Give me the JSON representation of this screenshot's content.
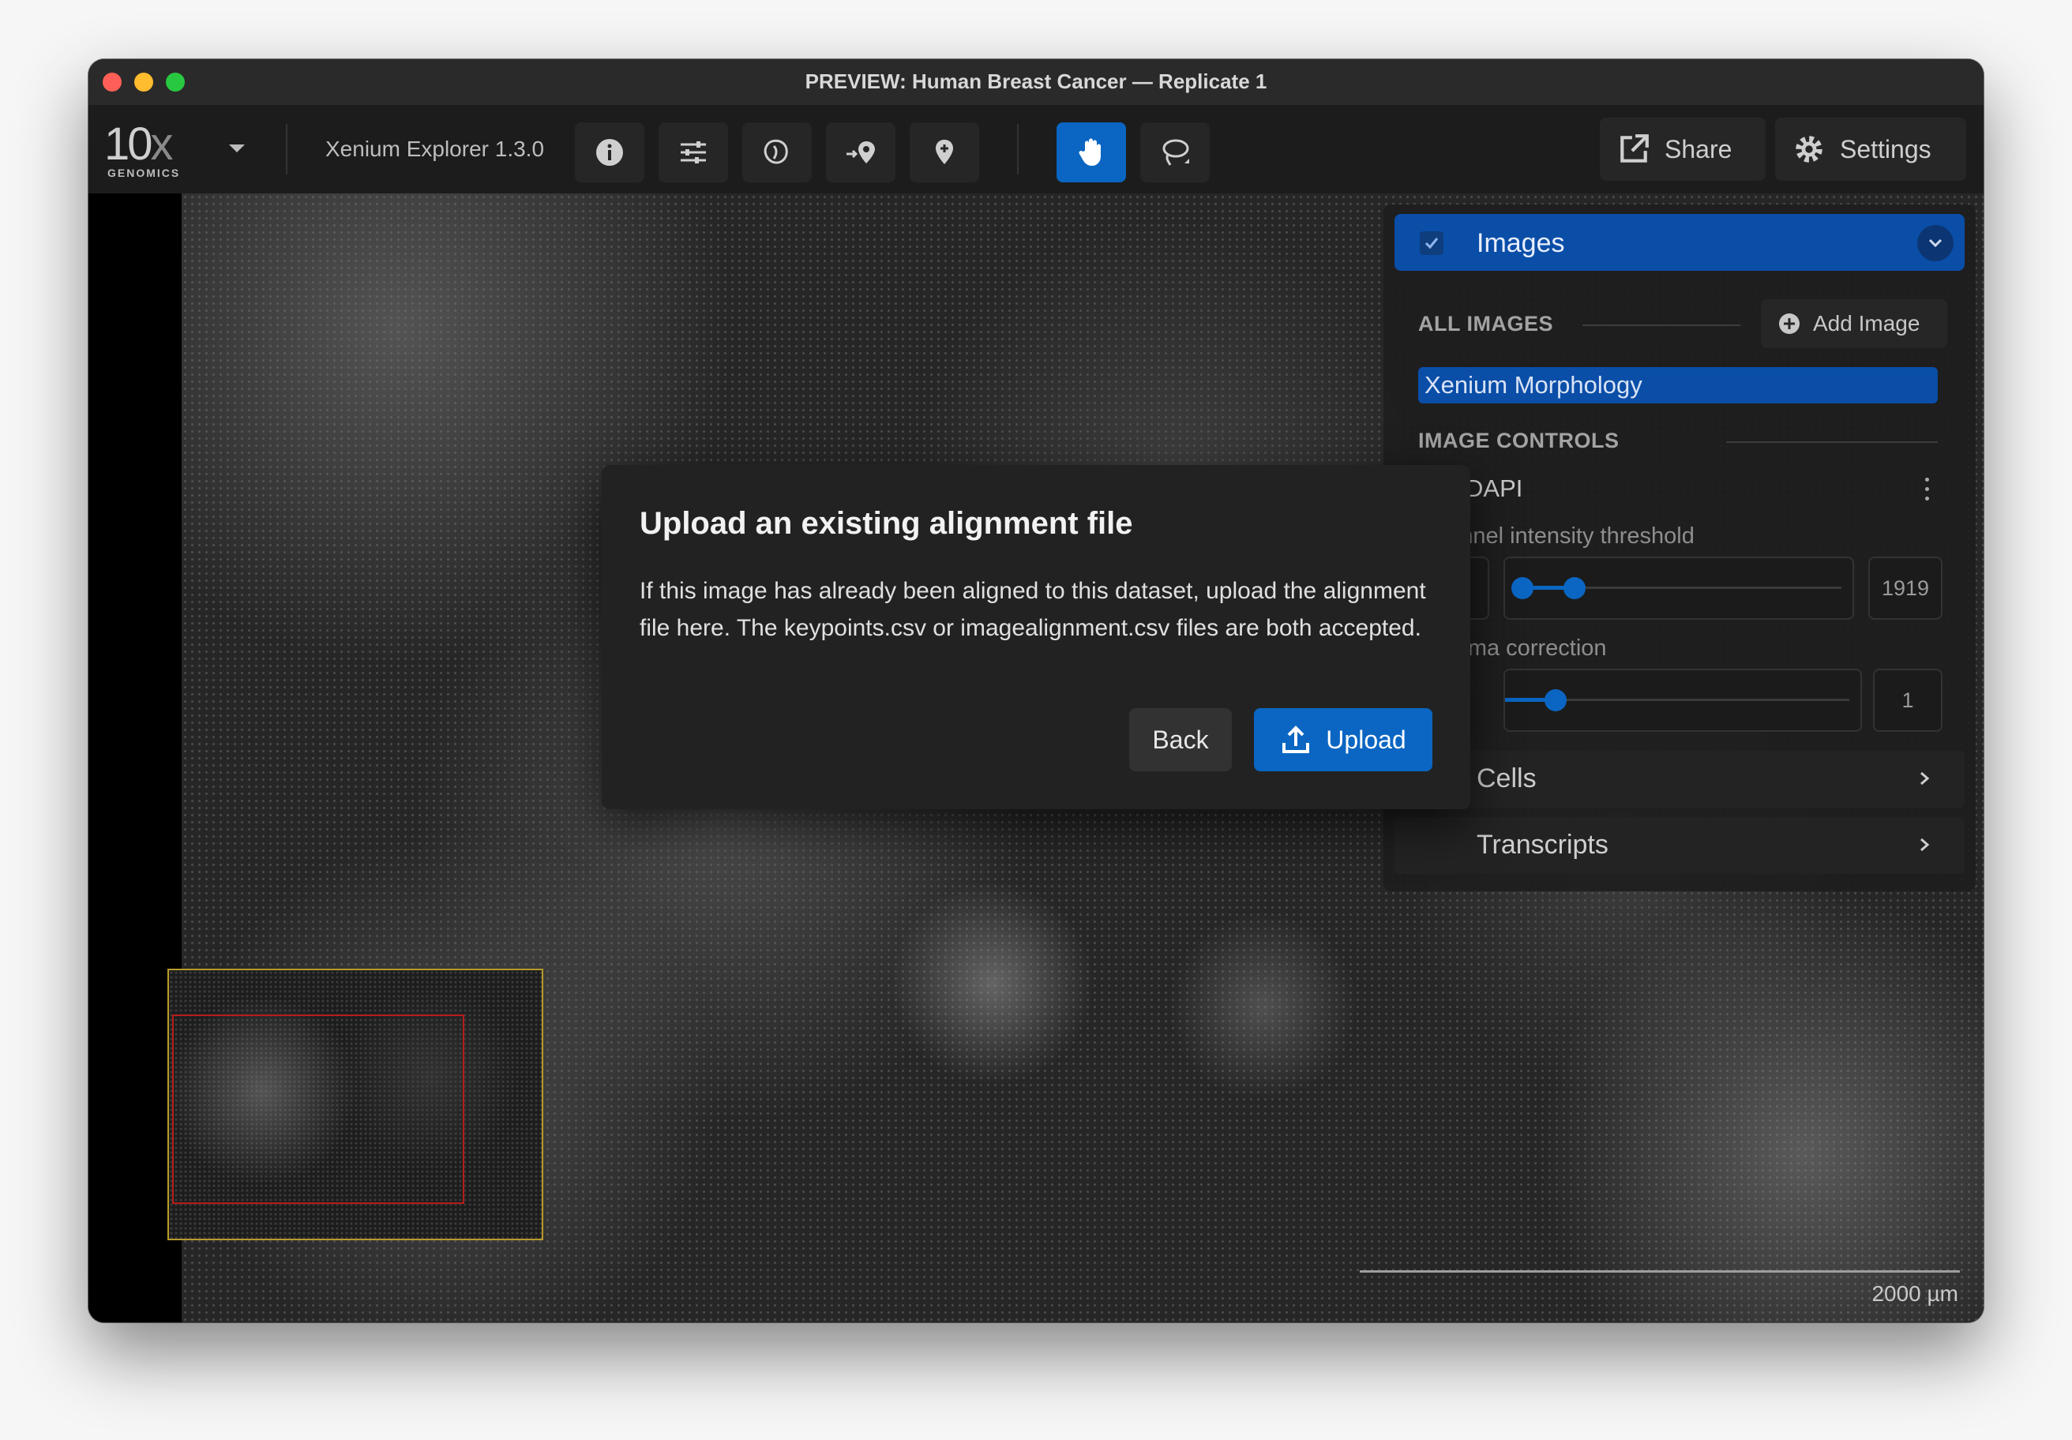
{
  "window": {
    "title": "PREVIEW: Human Breast Cancer — Replicate 1"
  },
  "toolbar": {
    "logo_main": "10",
    "logo_x": "x",
    "logo_sub": "GENOMICS",
    "app_version": "Xenium Explorer 1.3.0",
    "share_label": "Share",
    "settings_label": "Settings",
    "tools": [
      "info-icon",
      "sliders-icon",
      "cell-icon",
      "pin-arrow-icon",
      "pin-icon",
      "hand-icon",
      "lasso-icon"
    ],
    "active_tool": "hand-icon",
    "accent_color": "#0a66c2"
  },
  "panel": {
    "images_title": "Images",
    "all_images_label": "ALL IMAGES",
    "add_image_label": "Add Image",
    "selected_image": "Xenium Morphology",
    "image_controls_label": "IMAGE CONTROLS",
    "channel_name": "DAPI",
    "threshold_label": "Channel intensity threshold",
    "threshold_value": "1919",
    "gamma_label": "Gamma correction",
    "gamma_value": "1",
    "cells_label": "Cells",
    "transcripts_label": "Transcripts"
  },
  "viewer": {
    "scale_label": "2000 µm"
  },
  "dialog": {
    "title": "Upload an existing alignment file",
    "body": "If this image has already been aligned to this dataset, upload the alignment file here. The keypoints.csv or imagealignment.csv files are both accepted.",
    "back_label": "Back",
    "upload_label": "Upload"
  }
}
